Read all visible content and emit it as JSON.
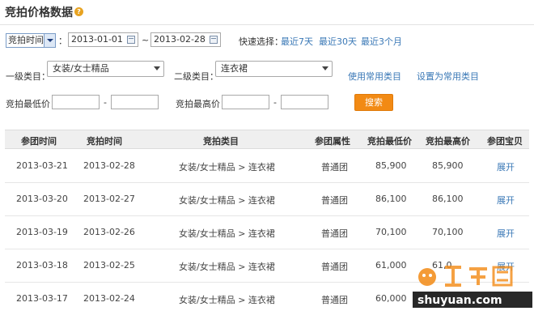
{
  "page": {
    "title": "竞拍价格数据",
    "help_icon": "help-icon"
  },
  "filters": {
    "time_type_value": "竞拍时间",
    "colon": "：",
    "start_date": "2013-01-01",
    "tilde": "~",
    "end_date": "2013-02-28",
    "quick_select_label": "快速选择：",
    "quick_links": [
      "最近7天",
      "最近30天",
      "最近3个月"
    ],
    "category1_label": "一级类目：",
    "category1_value": "女装/女士精品",
    "category2_label": "二级类目：",
    "category2_value": "连衣裙",
    "use_common_category": "使用常用类目",
    "set_common_category": "设置为常用类目",
    "min_price_label": "竞拍最低价：",
    "max_price_label": "竞拍最高价：",
    "dash": "-",
    "search_label": "搜索"
  },
  "table": {
    "headers": [
      "参团时间",
      "竞拍时间",
      "竞拍类目",
      "参团属性",
      "竞拍最低价",
      "竞拍最高价",
      "参团宝贝"
    ],
    "rows": [
      [
        "2013-03-21",
        "2013-02-28",
        "女装/女士精品 > 连衣裙",
        "普通团",
        "85,900",
        "85,900",
        "展开"
      ],
      [
        "2013-03-20",
        "2013-02-27",
        "女装/女士精品 > 连衣裙",
        "普通团",
        "86,100",
        "86,100",
        "展开"
      ],
      [
        "2013-03-19",
        "2013-02-26",
        "女装/女士精品 > 连衣裙",
        "普通团",
        "70,100",
        "70,100",
        "展开"
      ],
      [
        "2013-03-18",
        "2013-02-25",
        "女装/女士精品 > 连衣裙",
        "普通团",
        "61,000",
        "61,0",
        "展开"
      ],
      [
        "2013-03-17",
        "2013-02-24",
        "女装/女士精品 > 连衣裙",
        "普通团",
        "60,000",
        "",
        ""
      ]
    ]
  },
  "watermark": {
    "text": "shuyuan.com",
    "accent": "#f28a14"
  },
  "colors": {
    "link": "#3a78b6",
    "search_button": "#f28a14",
    "header_bg": "#efefef"
  }
}
